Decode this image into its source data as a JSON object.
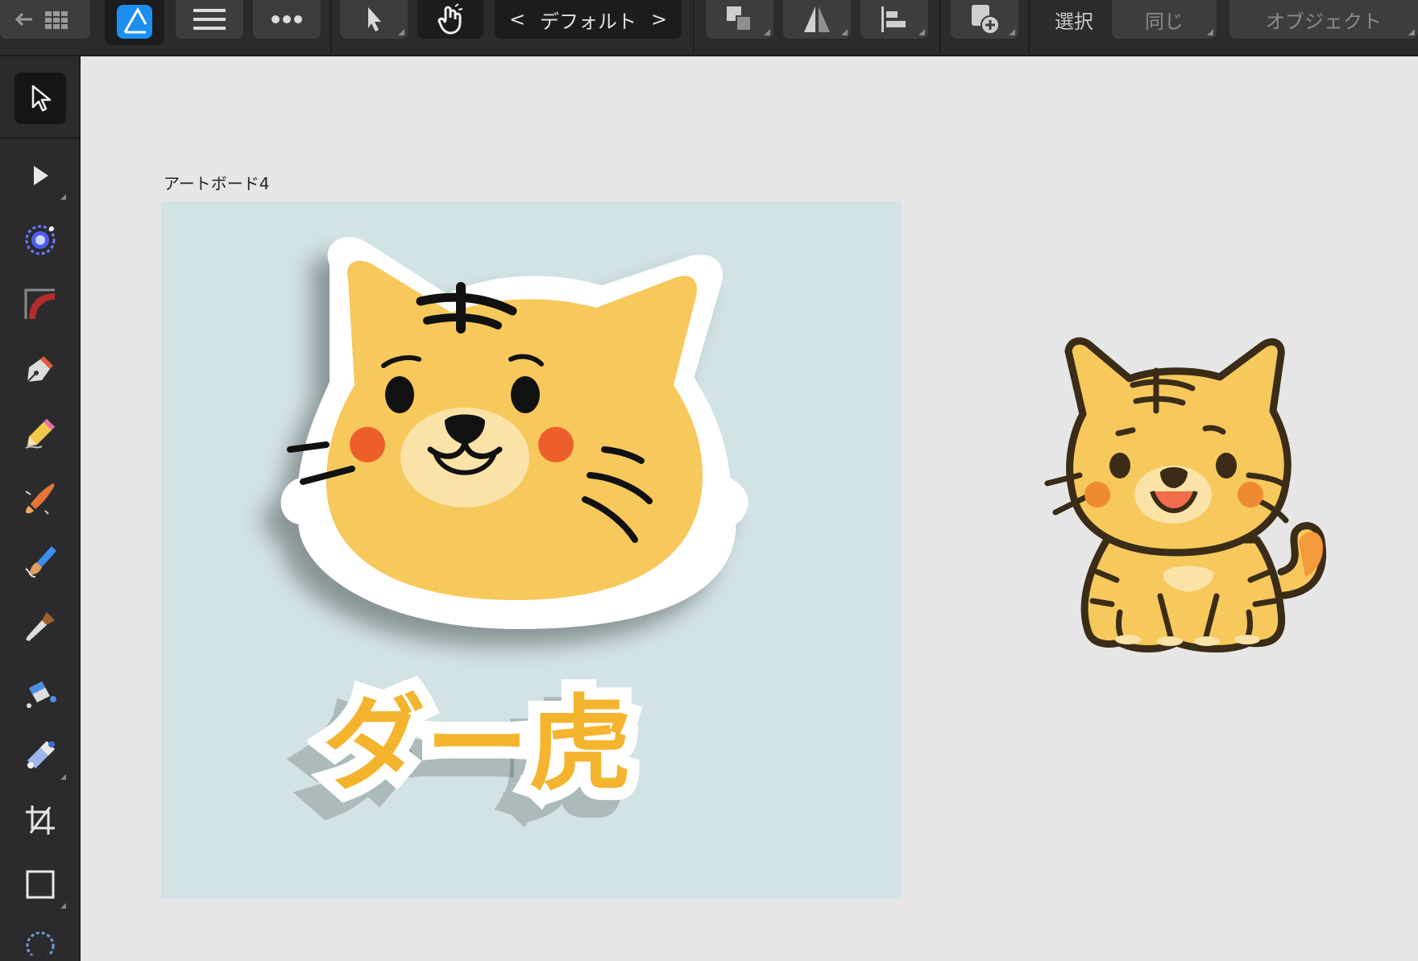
{
  "toolbar": {
    "persona_menu": "デフォルト",
    "select_label": "選択",
    "same_label": "同じ",
    "object_label": "オブジェクト"
  },
  "tools": [
    {
      "name": "move-tool",
      "icon": "arrow-icon"
    },
    {
      "name": "node-tool",
      "icon": "triangle-arrow-icon"
    },
    {
      "name": "contour-tool",
      "icon": "contour-icon"
    },
    {
      "name": "corner-tool",
      "icon": "corner-icon"
    },
    {
      "name": "pen-tool",
      "icon": "pen-icon"
    },
    {
      "name": "pencil-tool",
      "icon": "pencil-icon"
    },
    {
      "name": "vector-brush-tool",
      "icon": "vector-brush-icon"
    },
    {
      "name": "paint-brush-tool",
      "icon": "brush-icon"
    },
    {
      "name": "knife-tool",
      "icon": "knife-icon"
    },
    {
      "name": "fill-tool",
      "icon": "fill-icon"
    },
    {
      "name": "transparency-tool",
      "icon": "gradient-icon"
    },
    {
      "name": "crop-tool",
      "icon": "crop-icon"
    },
    {
      "name": "rectangle-tool",
      "icon": "rectangle-icon"
    }
  ],
  "canvas": {
    "artboard_label": "アートボード4",
    "logo_text": "ダー虎"
  },
  "colors": {
    "ui_dark": "#2b2b2d",
    "button": "#3d3d40",
    "canvas_bg": "#e6e6e6",
    "artboard_bg": "#d2e3e6",
    "tiger_fill": "#f7c85c",
    "logo_text": "#f5b42e",
    "cheek": "#ec5f2b",
    "muzzle": "#fbe3a8"
  }
}
